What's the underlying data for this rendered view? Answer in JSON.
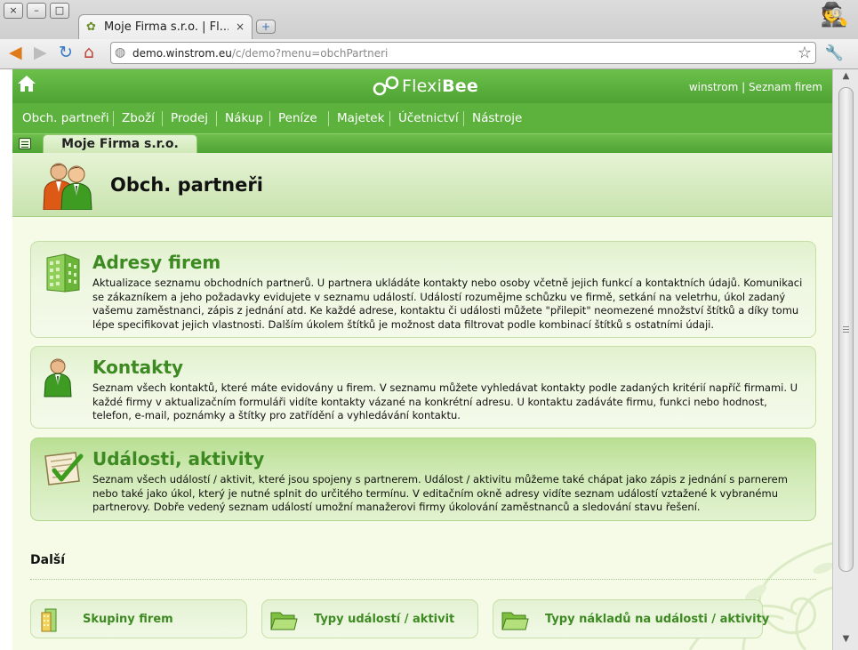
{
  "browser": {
    "tab_title": "Moje Firma s.r.o. | Fl...",
    "tab_close": "×",
    "new_tab": "+",
    "url_host": "demo.winstrom.eu",
    "url_path": "/c/demo?menu=obchPartneri",
    "window_buttons": {
      "close": "×",
      "minimize": "–",
      "maximize": "□"
    }
  },
  "app": {
    "logo_light": "Flexi",
    "logo_bold": "Bee",
    "user": "winstrom",
    "user_sep": " | ",
    "company_list_link": "Seznam firem",
    "menu": [
      "Obch. partneři",
      "Zboží",
      "Prodej",
      "Nákup",
      "Peníze",
      "Majetek",
      "Účetnictví",
      "Nástroje"
    ],
    "company_name": "Moje Firma s.r.o.",
    "page_title": "Obch. partneři"
  },
  "cards": [
    {
      "title": "Adresy firem",
      "desc": "Aktualizace seznamu obchodních partnerů. U partnera ukládáte kontakty nebo osoby včetně jejich funkcí a kontaktních údajů. Komunikaci se zákazníkem a jeho požadavky evidujete v seznamu událostí. Událostí rozumějme schůzku ve firmě, setkání na veletrhu, úkol zadaný vašemu zaměstnanci, zápis z jednání atd. Ke každé adrese, kontaktu či události můžete \"přilepit\" neomezené množství štítků a díky tomu lépe specifikovat jejich vlastnosti. Dalším úkolem štítků je možnost data filtrovat podle kombinací štítků s ostatními údaji."
    },
    {
      "title": "Kontakty",
      "desc": "Seznam všech kontaktů, které máte evidovány u firem. V seznamu můžete vyhledávat kontakty podle zadaných kritérií napříč firmami. U každé firmy v aktualizačním formuláři vidíte kontakty vázané na konkrétní adresu. U kontaktu zadáváte firmu, funkci nebo hodnost, telefon, e-mail, poznámky a štítky pro zatřídění a vyhledávání kontaktu."
    },
    {
      "title": "Události, aktivity",
      "desc": "Seznam všech událostí / aktivit, které jsou spojeny s partnerem. Událost / aktivitu můžeme také chápat jako zápis z jednání s parnerem nebo také jako úkol, který je nutné splnit do určitého termínu. V editačním okně adresy vidíte seznam událostí vztažené k vybranému partnerovy. Dobře vedený seznam událostí umožní manažerovi firmy úkolování zaměstnanců a sledování stavu řešení."
    }
  ],
  "more": {
    "title": "Další",
    "links": [
      "Skupiny firem",
      "Typy událostí / aktivit",
      "Typy nákladů na události / aktivity"
    ]
  },
  "colors": {
    "accent_green": "#5cb23d",
    "title_green": "#3d8a22",
    "page_bg": "#f5fbe7"
  }
}
